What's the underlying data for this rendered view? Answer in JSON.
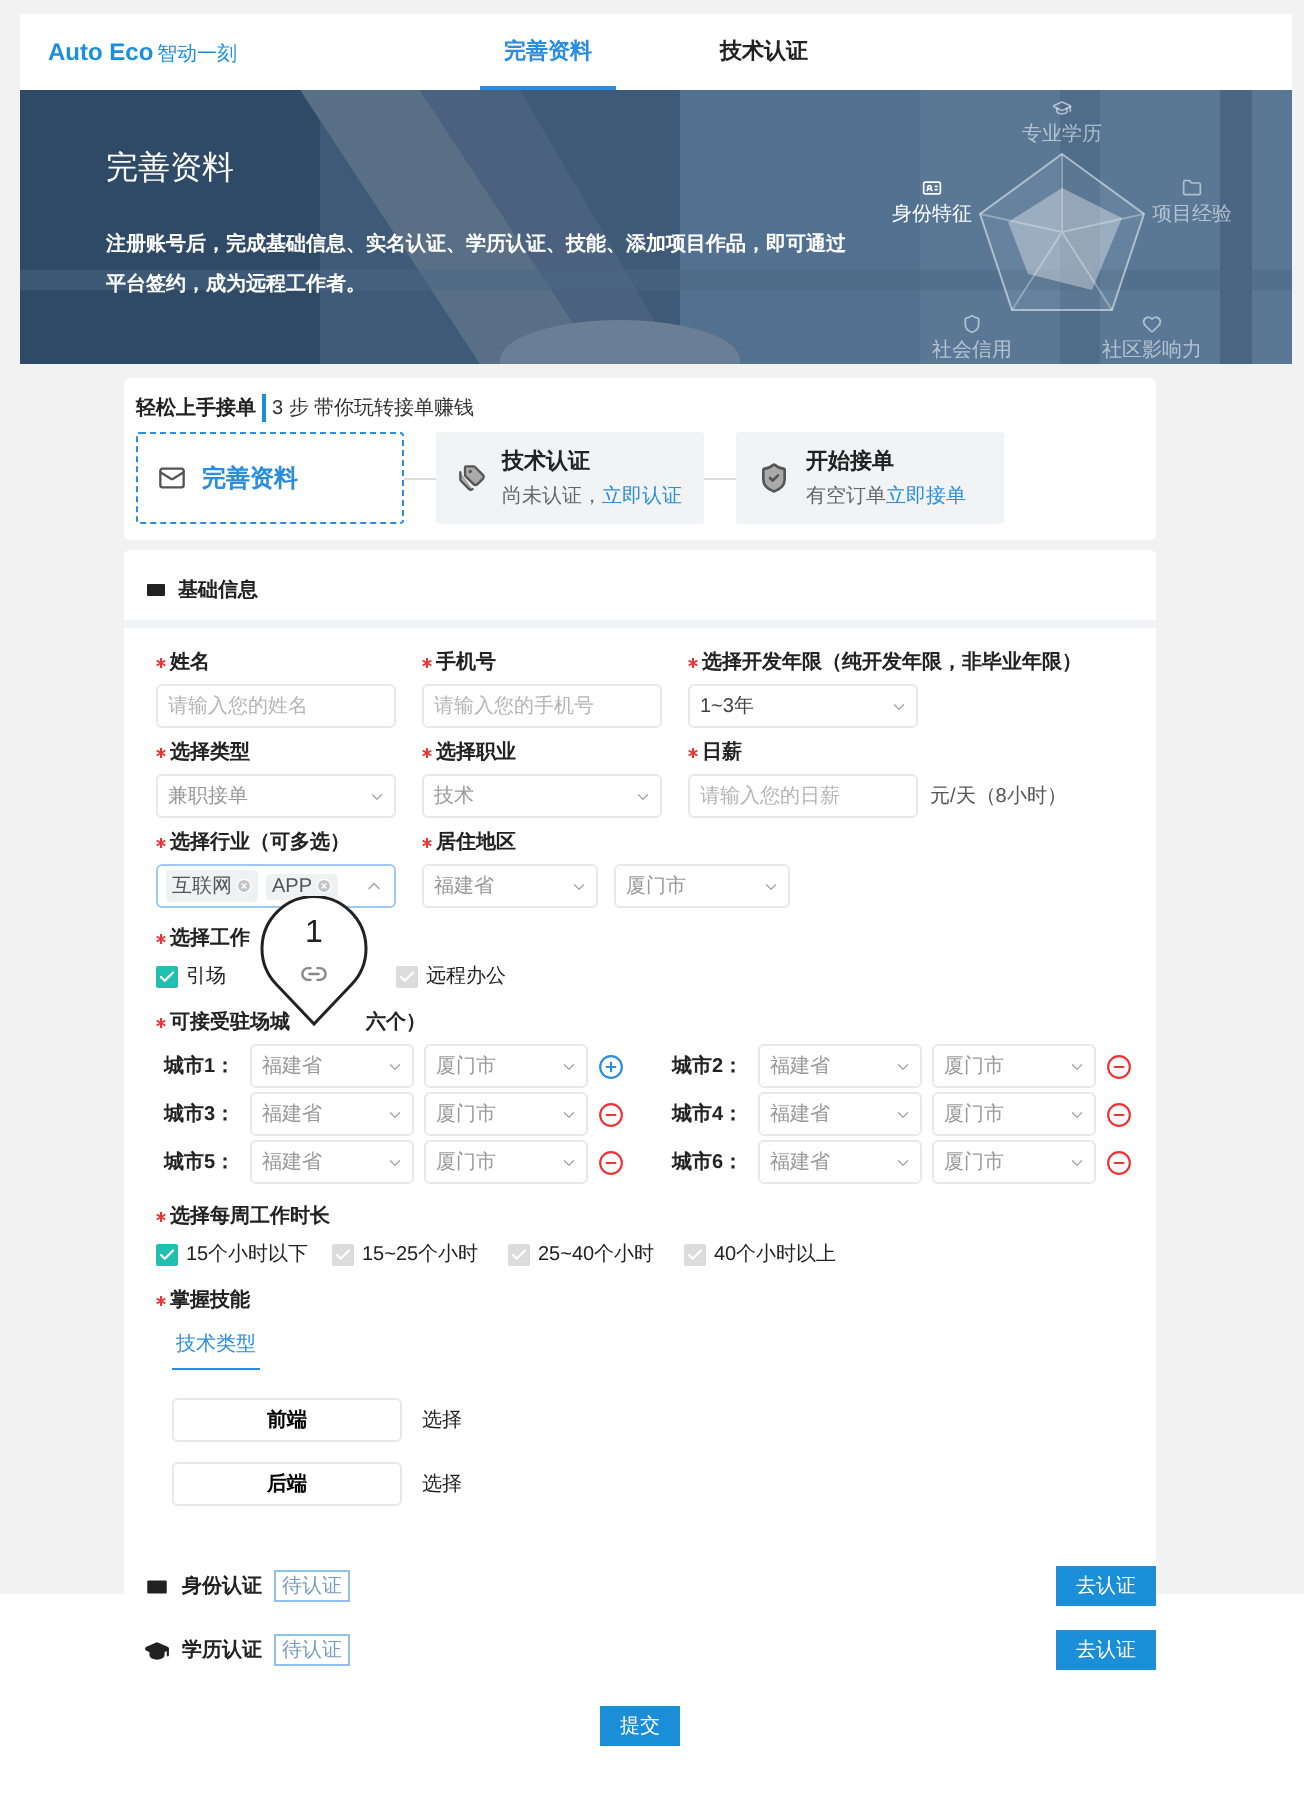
{
  "header": {
    "logo": "Auto Eco",
    "logo_sub": "智动一刻",
    "tabs": [
      {
        "label": "完善资料",
        "selected": true
      },
      {
        "label": "技术认证",
        "selected": false
      }
    ]
  },
  "banner": {
    "title": "完善资料",
    "description": "注册账号后，完成基础信息、实名认证、学历认证、技能、添加项目作品，即可通过平台签约，成为远程工作者。",
    "radar_labels": [
      {
        "label": "专业学历",
        "selected": false
      },
      {
        "label": "项目经验",
        "selected": false
      },
      {
        "label": "社区影响力",
        "selected": false
      },
      {
        "label": "社会信用",
        "selected": false
      },
      {
        "label": "身份特征",
        "selected": true
      }
    ]
  },
  "steps": {
    "title": "轻松上手接单",
    "subtitle": "3 步 带你玩转接单赚钱",
    "items": [
      {
        "title": "完善资料",
        "selected": true
      },
      {
        "title": "技术认证",
        "note": "尚未认证，",
        "link": "立即认证",
        "selected": false
      },
      {
        "title": "开始接单",
        "note": "有空订单",
        "link": "立即接单",
        "selected": false
      }
    ]
  },
  "basic": {
    "title": "基础信息",
    "fields": [
      {
        "kind": "input",
        "label": "姓名",
        "required": true,
        "placeholder": "请输入您的姓名"
      },
      {
        "kind": "input",
        "label": "手机号",
        "required": true,
        "placeholder": "请输入您的手机号"
      },
      {
        "kind": "select",
        "label": "选择开发年限（纯开发年限，非毕业年限）",
        "required": true,
        "value": "1~3年"
      },
      {
        "kind": "select",
        "label": "选择类型",
        "required": true,
        "value": "兼职接单"
      },
      {
        "kind": "select",
        "label": "选择职业",
        "required": true,
        "value": "技术"
      },
      {
        "kind": "input",
        "label": "日薪",
        "required": true,
        "placeholder": "请输入您的日薪",
        "suffix": "元/天（8小时）"
      },
      {
        "kind": "tags",
        "label": "选择行业（可多选）",
        "required": true,
        "tags": [
          "互联网",
          "APP"
        ],
        "expanded": true
      },
      {
        "kind": "region",
        "label": "居住地区",
        "required": true,
        "values": [
          "福建省",
          "厦门市"
        ]
      }
    ],
    "work_type": {
      "label": "选择工作",
      "required": true,
      "options": [
        {
          "label": "引场",
          "checked": true
        },
        {
          "label": "远程办公",
          "checked": false
        }
      ]
    },
    "cities": {
      "label": "可接受驻场城",
      "label_end": "六个）",
      "required": true,
      "items": [
        {
          "label": "城市1：",
          "province": "福建省",
          "city": "厦门市",
          "kind": "add"
        },
        {
          "label": "城市2：",
          "province": "福建省",
          "city": "厦门市",
          "kind": "remove"
        },
        {
          "label": "城市3：",
          "province": "福建省",
          "city": "厦门市",
          "kind": "remove"
        },
        {
          "label": "城市4：",
          "province": "福建省",
          "city": "厦门市",
          "kind": "remove"
        },
        {
          "label": "城市5：",
          "province": "福建省",
          "city": "厦门市",
          "kind": "remove"
        },
        {
          "label": "城市6：",
          "province": "福建省",
          "city": "厦门市",
          "kind": "remove"
        }
      ]
    },
    "hours": {
      "label": "选择每周工作时长",
      "required": true,
      "options": [
        {
          "label": "15个小时以下",
          "checked": true
        },
        {
          "label": "15~25个小时",
          "checked": false
        },
        {
          "label": "25~40个小时",
          "checked": false
        },
        {
          "label": "40个小时以上",
          "checked": false
        }
      ]
    },
    "skills": {
      "label": "掌握技能",
      "required": true,
      "tabs": [
        {
          "label": "技术类型",
          "selected": true
        }
      ],
      "items": [
        {
          "name": "前端",
          "action": "选择"
        },
        {
          "name": "后端",
          "action": "选择"
        }
      ]
    },
    "certifications": [
      {
        "kind": "identity",
        "title": "身份认证",
        "status": "待认证",
        "button": "去认证"
      },
      {
        "kind": "education",
        "title": "学历认证",
        "status": "待认证",
        "button": "去认证"
      }
    ],
    "submit": "提交"
  },
  "pin": {
    "number": "1"
  }
}
